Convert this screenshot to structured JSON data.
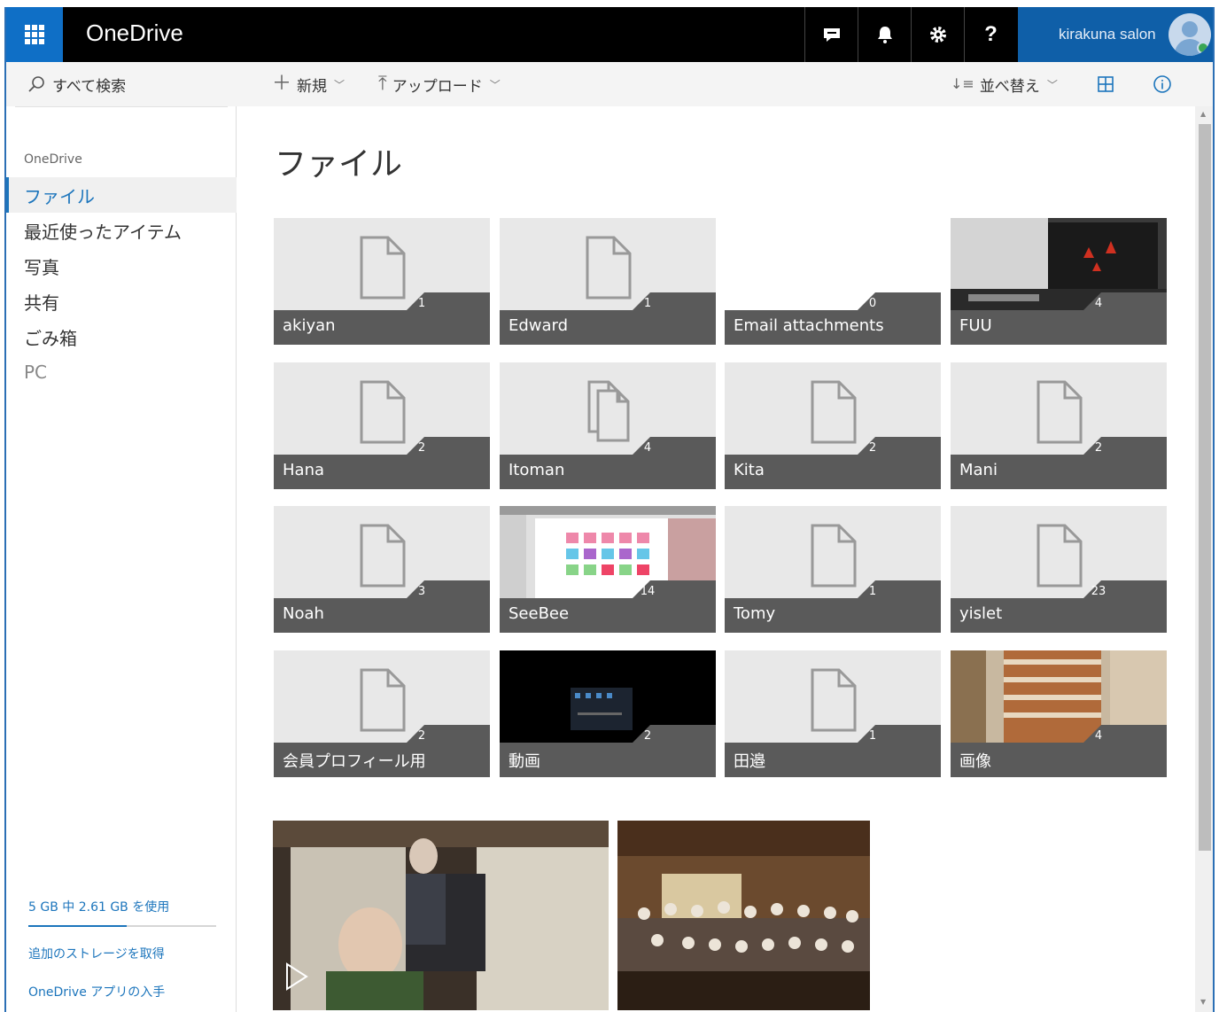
{
  "topbar": {
    "app_title": "OneDrive",
    "account_name": "kirakuna salon",
    "icons": [
      "feedback-icon",
      "bell-icon",
      "gear-icon",
      "help-icon"
    ],
    "help_label": "?"
  },
  "search": {
    "placeholder": "すべて検索"
  },
  "commands": {
    "new_label": "新規",
    "upload_label": "アップロード",
    "sort_label": "並べ替え"
  },
  "nav": {
    "header": "OneDrive",
    "items": [
      {
        "label": "ファイル",
        "active": true
      },
      {
        "label": "最近使ったアイテム"
      },
      {
        "label": "写真"
      },
      {
        "label": "共有"
      },
      {
        "label": "ごみ箱"
      },
      {
        "label": "PC"
      }
    ],
    "storage_text": "5 GB 中 2.61 GB を使用",
    "storage_used_fraction": 0.522,
    "link_storage": "追加のストレージを取得",
    "link_app": "OneDrive アプリの入手"
  },
  "main": {
    "title": "ファイル",
    "folders": [
      {
        "name": "akiyan",
        "count": "1"
      },
      {
        "name": "Edward",
        "count": "1"
      },
      {
        "name": "Email attachments",
        "count": "0"
      },
      {
        "name": "FUU",
        "count": "4"
      },
      {
        "name": "Hana",
        "count": "2"
      },
      {
        "name": "Itoman",
        "count": "4"
      },
      {
        "name": "Kita",
        "count": "2"
      },
      {
        "name": "Mani",
        "count": "2"
      },
      {
        "name": "Noah",
        "count": "3"
      },
      {
        "name": "SeeBee",
        "count": "14"
      },
      {
        "name": "Tomy",
        "count": "1"
      },
      {
        "name": "yislet",
        "count": "23"
      },
      {
        "name": "会員プロフィール用",
        "count": "2"
      },
      {
        "name": "動画",
        "count": "2"
      },
      {
        "name": "田邉",
        "count": "1"
      },
      {
        "name": "画像",
        "count": "4"
      }
    ]
  },
  "colors": {
    "accent": "#1c75bc",
    "topbar": "#000000",
    "waffle": "#0f6fc6",
    "label_bar": "#5a5a5a",
    "tile_bg": "#e8e8e8"
  }
}
